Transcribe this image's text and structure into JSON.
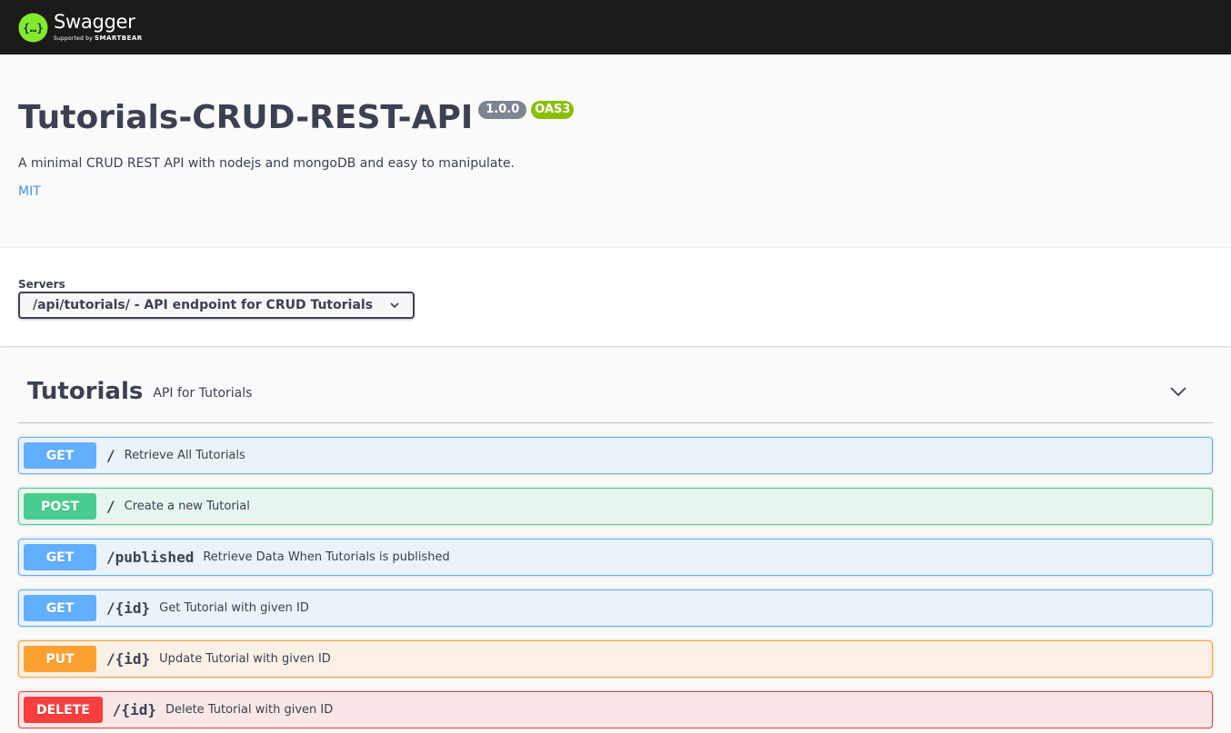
{
  "topbar": {
    "brand_name": "Swagger",
    "brand_sub_prefix": "Supported by",
    "brand_sub_company": "SMARTBEAR",
    "logo_icon": "swagger-braces-icon",
    "brand_color": "#85ea2d"
  },
  "info": {
    "title": "Tutorials-CRUD-REST-API",
    "version": "1.0.0",
    "oas_badge": "OAS3",
    "description": "A minimal CRUD REST API with nodejs and mongoDB and easy to manipulate.",
    "license": "MIT"
  },
  "servers": {
    "label": "Servers",
    "selected": "/api/tutorials/ - API endpoint for CRUD Tutorials"
  },
  "tag": {
    "name": "Tutorials",
    "description": "API for Tutorials",
    "expanded": true
  },
  "operations": [
    {
      "method": "GET",
      "path": "/",
      "summary": "Retrieve All Tutorials"
    },
    {
      "method": "POST",
      "path": "/",
      "summary": "Create a new Tutorial"
    },
    {
      "method": "GET",
      "path": "/published",
      "summary": "Retrieve Data When Tutorials is published"
    },
    {
      "method": "GET",
      "path": "/{id}",
      "summary": "Get Tutorial with given ID"
    },
    {
      "method": "PUT",
      "path": "/{id}",
      "summary": "Update Tutorial with given ID"
    },
    {
      "method": "DELETE",
      "path": "/{id}",
      "summary": "Delete Tutorial with given ID"
    }
  ],
  "colors": {
    "get": "#61affe",
    "post": "#49cc90",
    "put": "#fca130",
    "delete": "#f93e3e",
    "link": "#4990e2",
    "oas_badge": "#89bf04",
    "version_badge": "#7d8492"
  }
}
